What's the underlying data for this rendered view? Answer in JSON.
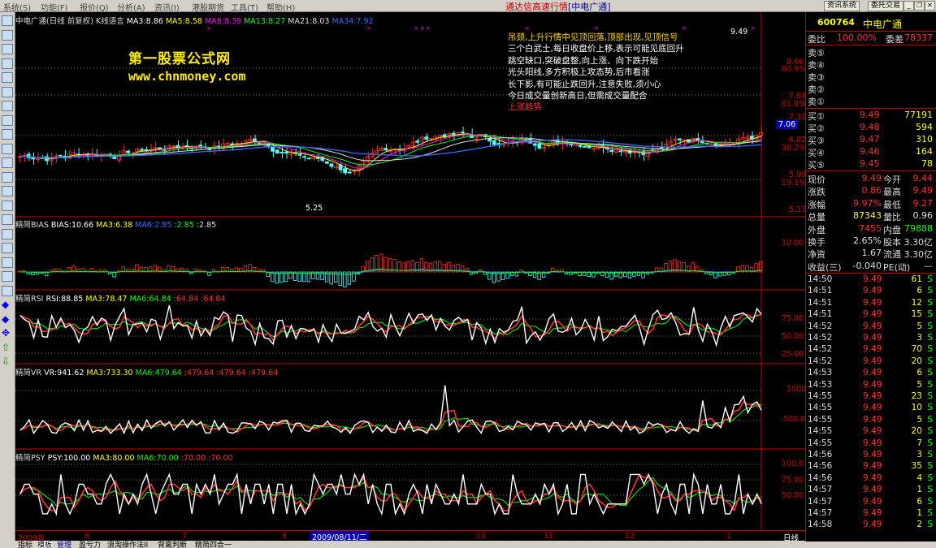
{
  "menu": [
    "系统(S)",
    "功能(F)",
    "报价(Q)",
    "分析(A)",
    "资讯(I)",
    "港股期货",
    "工具(T)",
    "帮助(H)"
  ],
  "app_title": "通达信高速行情",
  "app_title_stock": "[中电广通]",
  "top_buttons": {
    "trade_system": "资讯系统",
    "delegate": "委托交易"
  },
  "chart": {
    "main_caption": {
      "name": "中电广通(日线 前复权)",
      "indicator": "K线语言",
      "ma3": "MA3:8.86",
      "ma5": "MA5:8.58",
      "ma8": "MA8:8.39",
      "ma13": "MA13:8.27",
      "ma21": "MA21:8.03",
      "ma34": "MA34:7.92"
    },
    "price_axis": [
      "8.66",
      "80.9%",
      "7.84",
      "61.8%",
      "7.32",
      "6.82",
      "38.2%",
      "5.99",
      "19.1%",
      "5.17"
    ],
    "cursor_price": "7.06",
    "high_mark": "9.49",
    "low_mark": "5.25",
    "watermark1": "第一股票公式网",
    "watermark2": "www.chnmoney.com",
    "signals": [
      {
        "text": "吊颈,上升行情中见顶回落,顶部出现,见顶信号",
        "color": "#ffd700"
      },
      {
        "text": "三个白武士,每日收盘价上移,表示可能见底回升",
        "color": "#ffffff"
      },
      {
        "text": "跳空缺口,突破盘整,向上涨、向下跌开始",
        "color": "#ffffff"
      },
      {
        "text": "光头阳线,多方积极上攻态势,后市看涨",
        "color": "#ffffff"
      },
      {
        "text": "长下影,有可能止跌回升,注意失败,须小心",
        "color": "#ffffff"
      },
      {
        "text": "今日成交量创新高日,但需成交量配合",
        "color": "#ffffff"
      },
      {
        "text": "上涨趋势",
        "color": "#ff3030"
      }
    ],
    "bias": {
      "name": "精简BIAS",
      "value": "BIAS:10.66",
      "ma3": "MA3:6.38",
      "ma6": "MA6:2.85",
      "extra1": ":2.85",
      "extra2": ":2.85",
      "axis": [
        "10.00"
      ]
    },
    "rsi": {
      "name": "精简RSI",
      "value": "RSI:88.85",
      "ma3": "MA3:78.47",
      "ma6": "MA6:64.84",
      "extra1": ":64.84",
      "extra2": ":64.84",
      "axis": [
        "75.00",
        "50.00",
        "25.00"
      ]
    },
    "vr": {
      "name": "精简VR",
      "value": "VR:941.62",
      "ma3": "MA3:733.30",
      "ma6": "MA6:479.64",
      "extra1": ":479.64",
      "extra2": ":479.64",
      "extra3": ":479.64",
      "axis": [
        "1000",
        "500.0"
      ]
    },
    "psy": {
      "name": "精简PSY",
      "value": "PSY:100.00",
      "ma3": "MA3:80.00",
      "ma6": "MA6:70.00",
      "extra1": ":70.00",
      "extra2": ":70.00",
      "axis": [
        "100.0",
        "75.00",
        "50.00"
      ]
    },
    "x_axis": {
      "labels": [
        "2009年",
        "6",
        "7",
        "8",
        "10",
        "11",
        "12",
        "1"
      ],
      "cursor_date": "2009/08/11/二",
      "period": "日线"
    }
  },
  "tabs": [
    "指标",
    "模板",
    "管理",
    "盈亏力",
    "浪淘操作法II",
    "背离判断",
    "精简四合一"
  ],
  "quote": {
    "code": "600764",
    "name": "中电广通",
    "weibi_label": "委比",
    "weibi": "100.00%",
    "weicha_label": "委差",
    "weicha": "78337",
    "asks": [
      {
        "label": "卖⑤"
      },
      {
        "label": "卖④"
      },
      {
        "label": "卖③"
      },
      {
        "label": "卖②"
      },
      {
        "label": "卖①"
      }
    ],
    "bids": [
      {
        "label": "买①",
        "price": "9.49",
        "vol": "77191"
      },
      {
        "label": "买②",
        "price": "9.48",
        "vol": "594"
      },
      {
        "label": "买③",
        "price": "9.47",
        "vol": "310"
      },
      {
        "label": "买④",
        "price": "9.46",
        "vol": "164"
      },
      {
        "label": "买⑤",
        "price": "9.45",
        "vol": "78"
      }
    ],
    "stats": [
      {
        "l1": "现价",
        "v1": "9.49",
        "l2": "今开",
        "v2": "9.44"
      },
      {
        "l1": "涨跌",
        "v1": "0.86",
        "l2": "最高",
        "v2": "9.49"
      },
      {
        "l1": "涨幅",
        "v1": "9.97%",
        "l2": "最低",
        "v2": "9.27"
      },
      {
        "l1": "总量",
        "v1": "87343",
        "l2": "量比",
        "v2": "0.96"
      },
      {
        "l1": "外盘",
        "v1": "7455",
        "l2": "内盘",
        "v2": "79888"
      },
      {
        "l1": "换手",
        "v1": "2.65%",
        "l2": "股本",
        "v2": "3.30亿"
      },
      {
        "l1": "净资",
        "v1": "1.67",
        "l2": "流通",
        "v2": "3.30亿"
      },
      {
        "l1": "收益(三)",
        "v1": "-0.040",
        "l2": "PE(动)",
        "v2": "—"
      }
    ],
    "ticks": [
      {
        "t": "14:50",
        "p": "9.49",
        "v": "61",
        "s": "S"
      },
      {
        "t": "14:51",
        "p": "9.49",
        "v": "6",
        "s": "S"
      },
      {
        "t": "14:51",
        "p": "9.49",
        "v": "12",
        "s": "S"
      },
      {
        "t": "14:51",
        "p": "9.49",
        "v": "15",
        "s": "S"
      },
      {
        "t": "14:52",
        "p": "9.49",
        "v": "5",
        "s": "S"
      },
      {
        "t": "14:52",
        "p": "9.49",
        "v": "3",
        "s": "S"
      },
      {
        "t": "14:52",
        "p": "9.49",
        "v": "70",
        "s": "S"
      },
      {
        "t": "14:52",
        "p": "9.49",
        "v": "20",
        "s": "S"
      },
      {
        "t": "14:53",
        "p": "9.49",
        "v": "6",
        "s": "S"
      },
      {
        "t": "14:53",
        "p": "9.49",
        "v": "5",
        "s": "S"
      },
      {
        "t": "14:55",
        "p": "9.49",
        "v": "23",
        "s": "S"
      },
      {
        "t": "14:55",
        "p": "9.49",
        "v": "10",
        "s": "S"
      },
      {
        "t": "14:55",
        "p": "9.49",
        "v": "5",
        "s": "S"
      },
      {
        "t": "14:55",
        "p": "9.49",
        "v": "20",
        "s": "S"
      },
      {
        "t": "14:55",
        "p": "9.49",
        "v": "7",
        "s": "S"
      },
      {
        "t": "14:56",
        "p": "9.49",
        "v": "3",
        "s": "S"
      },
      {
        "t": "14:56",
        "p": "9.49",
        "v": "35",
        "s": "S"
      },
      {
        "t": "14:56",
        "p": "9.49",
        "v": "4",
        "s": "S"
      },
      {
        "t": "14:57",
        "p": "9.49",
        "v": "1",
        "s": "S"
      },
      {
        "t": "14:57",
        "p": "9.49",
        "v": "6",
        "s": "S"
      },
      {
        "t": "14:57",
        "p": "9.49",
        "v": "1",
        "s": "S"
      },
      {
        "t": "14:58",
        "p": "9.49",
        "v": "2",
        "s": "S"
      }
    ]
  }
}
